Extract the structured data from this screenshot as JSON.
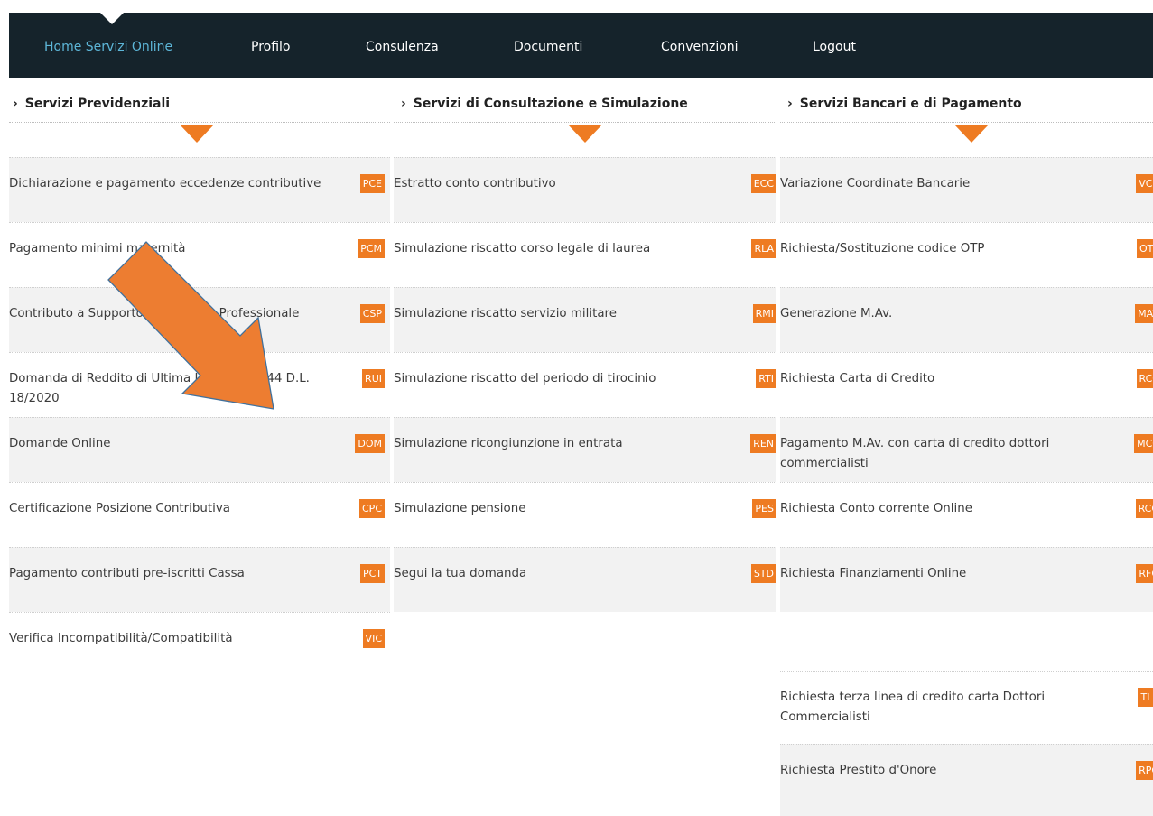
{
  "nav": {
    "items": [
      {
        "label": "Home Servizi Online",
        "active": true
      },
      {
        "label": "Profilo",
        "active": false
      },
      {
        "label": "Consulenza",
        "active": false
      },
      {
        "label": "Documenti",
        "active": false
      },
      {
        "label": "Convenzioni",
        "active": false
      },
      {
        "label": "Logout",
        "active": false
      }
    ]
  },
  "colors": {
    "accent": "#ee7b22",
    "navbar": "#15232b",
    "active_link": "#5db6d8",
    "row_shade": "#f2f2f2"
  },
  "icons": {
    "header_chevron": "chevron-right-icon",
    "section_marker": "triangle-down-icon",
    "overlay": "arrow-down-right-icon"
  },
  "columns": [
    {
      "title": "Servizi Previdenziali",
      "items": [
        {
          "label": "Dichiarazione e pagamento eccedenze contributive",
          "code": "PCE"
        },
        {
          "label": "Pagamento minimi maternità",
          "code": "PCM"
        },
        {
          "label": "Contributo a Supporto dell'attività Professionale",
          "code": "CSP"
        },
        {
          "label": "Domanda di Reddito di Ultima Istanza art. 44 D.L. 18/2020",
          "code": "RUI"
        },
        {
          "label": "Domande Online",
          "code": "DOM"
        },
        {
          "label": "Certificazione Posizione Contributiva",
          "code": "CPC"
        },
        {
          "label": "Pagamento contributi pre-iscritti Cassa",
          "code": "PCT"
        },
        {
          "label": "Verifica Incompatibilità/Compatibilità",
          "code": "VIC"
        }
      ]
    },
    {
      "title": "Servizi di Consultazione e Simulazione",
      "items": [
        {
          "label": "Estratto conto contributivo",
          "code": "ECC"
        },
        {
          "label": "Simulazione riscatto corso legale di laurea",
          "code": "RLA"
        },
        {
          "label": "Simulazione riscatto servizio militare",
          "code": "RMI"
        },
        {
          "label": "Simulazione riscatto del periodo di tirocinio",
          "code": "RTI"
        },
        {
          "label": "Simulazione ricongiunzione in entrata",
          "code": "REN"
        },
        {
          "label": "Simulazione pensione",
          "code": "PES"
        },
        {
          "label": "Segui la tua domanda",
          "code": "STD"
        }
      ]
    },
    {
      "title": "Servizi Bancari e di Pagamento",
      "items": [
        {
          "label": "Variazione Coordinate Bancarie",
          "code": "VCB"
        },
        {
          "label": "Richiesta/Sostituzione codice OTP",
          "code": "OTP"
        },
        {
          "label": "Generazione M.Av.",
          "code": "MAV"
        },
        {
          "label": "Richiesta Carta di Credito",
          "code": "RCC"
        },
        {
          "label": "Pagamento M.Av. con carta di credito dottori commercialisti",
          "code": "MCC"
        },
        {
          "label": "Richiesta Conto corrente Online",
          "code": "RCO"
        },
        {
          "label": "Richiesta Finanziamenti Online",
          "code": "RFO"
        },
        {
          "label": "Richiesta terza linea di credito carta Dottori Commercialisti",
          "code": "TLC"
        },
        {
          "label": "Richiesta Prestito d'Onore",
          "code": "RPO"
        }
      ]
    }
  ]
}
